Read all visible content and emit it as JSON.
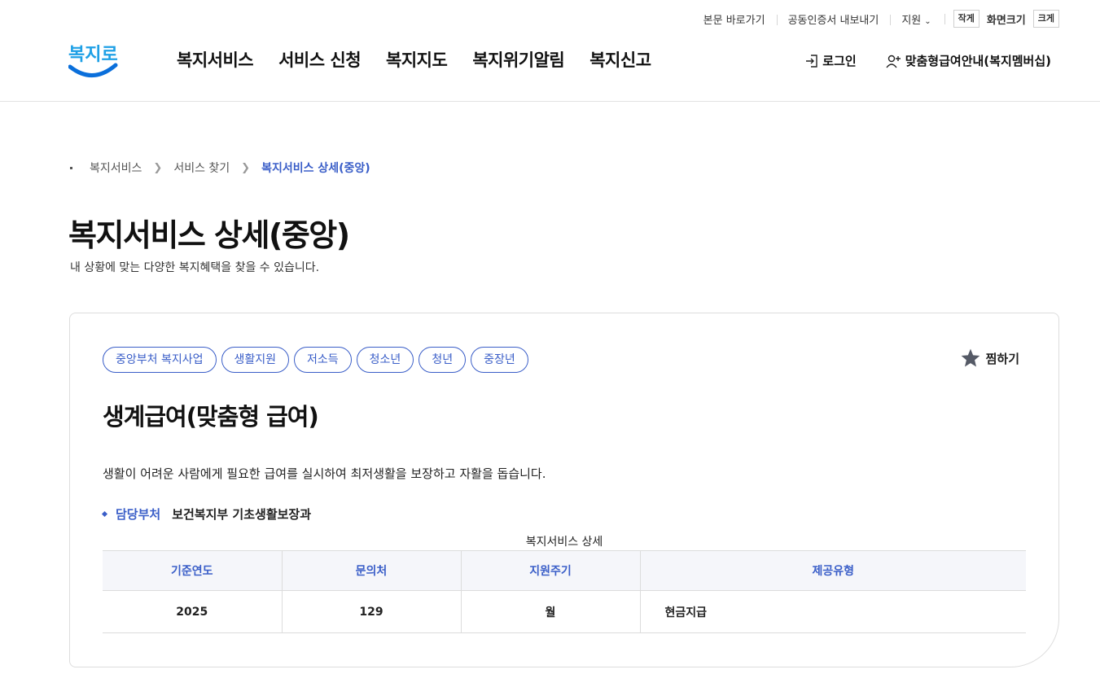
{
  "colors": {
    "accent": "#3a5ec8",
    "logo_blue": "#1ea0e6",
    "logo_smile": "#0a6fdb",
    "text": "#111111"
  },
  "util_nav": {
    "skip_to_content": "본문 바로가기",
    "export_certificate": "공동인증서 내보내기",
    "support": "지원",
    "font_small": "작게",
    "font_size_label": "화면크기",
    "font_large": "크게"
  },
  "logo": {
    "text": "복지로"
  },
  "gnb": {
    "items": [
      "복지서비스",
      "서비스 신청",
      "복지지도",
      "복지위기알림",
      "복지신고"
    ]
  },
  "header_right": {
    "login": "로그인",
    "membership": "맞춤형급여안내(복지멤버십)"
  },
  "breadcrumb": {
    "items": [
      "복지서비스",
      "서비스 찾기",
      "복지서비스 상세(중앙)"
    ]
  },
  "page": {
    "title": "복지서비스 상세(중앙)",
    "description": "내 상황에 맞는 다양한 복지혜택을 찾을 수 있습니다."
  },
  "service": {
    "tags": [
      "중앙부처 복지사업",
      "생활지원",
      "저소득",
      "청소년",
      "청년",
      "중장년"
    ],
    "bookmark_label": "찜하기",
    "title": "생계급여(맞춤형 급여)",
    "description": "생활이 어려운 사람에게 필요한 급여를 실시하여 최저생활을 보장하고 자활을 돕습니다.",
    "department_label": "담당부처",
    "department_value": "보건복지부 기초생활보장과",
    "table": {
      "caption": "복지서비스 상세",
      "headers": [
        "기준연도",
        "문의처",
        "지원주기",
        "제공유형"
      ],
      "row": [
        "2025",
        "129",
        "월",
        "현금지급"
      ]
    }
  }
}
